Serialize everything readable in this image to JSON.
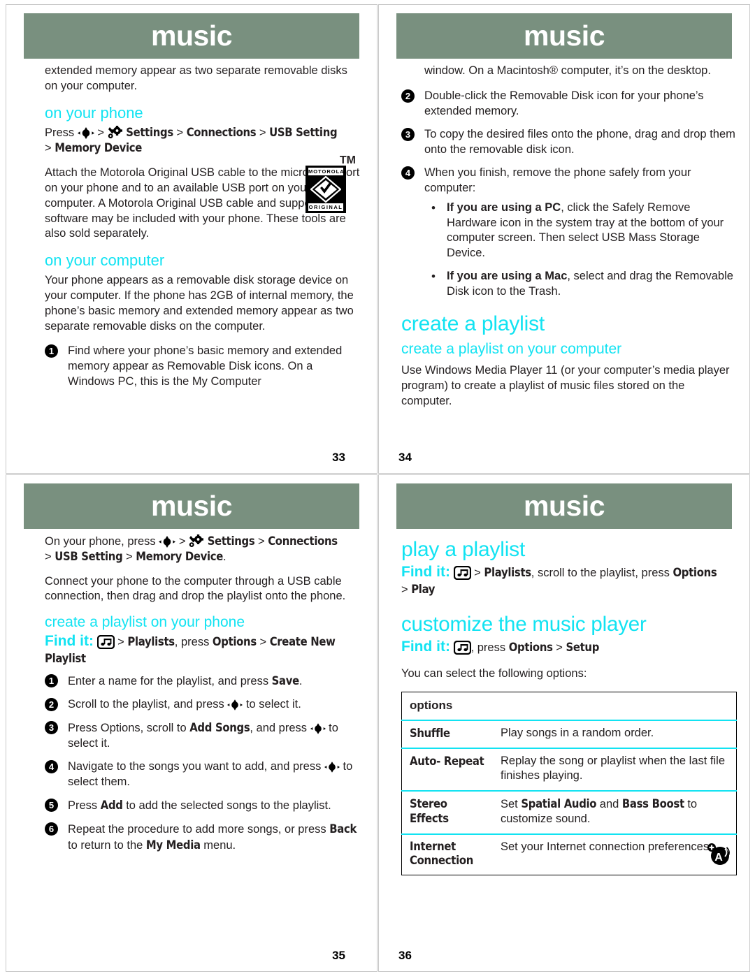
{
  "banner_title": "music",
  "colors": {
    "banner_green": "#79907f",
    "accent_cyan": "#12e3f2",
    "text": "#231f20"
  },
  "pages": [
    {
      "id": "33",
      "number": "33",
      "intro": "extended memory appear as two separate removable disks on your computer.",
      "h_phone": "on your phone",
      "path_press": "Press",
      "path_settings": "Settings",
      "path_connections": "Connections",
      "path_usb": "USB Setting",
      "path_memdev": "Memory Device",
      "gt": ">",
      "attach_para": "Attach the Motorola Original USB cable to the micro-USB port on your phone and to an available USB port on your computer. A Motorola Original USB cable and supporting software may be included with your phone. These tools are also sold separately.",
      "logo_top": "MOTOROLA",
      "logo_bottom": "ORIGINAL",
      "logo_tm": "TM",
      "h_computer": "on your computer",
      "computer_para": "Your phone appears as a removable disk storage device on your computer. If the phone has 2GB of internal memory, the phone’s basic memory and extended memory appear as two separate removable disks on the computer.",
      "step1_num": "❶",
      "step1": "Find where your phone’s basic memory and extended memory appear as Removable Disk icons. On a Windows PC, this is the My Computer"
    },
    {
      "id": "34",
      "number": "34",
      "cont": "window. On a Macintosh® computer, it’s on the desktop.",
      "step2_num": "❷",
      "step2": "Double-click the Removable Disk icon for your phone’s extended memory.",
      "step3_num": "❸",
      "step3": "To copy the desired files onto the phone, drag and drop them onto the removable disk icon.",
      "step4_num": "❹",
      "step4": "When you finish, remove the phone safely from your computer:",
      "bullet_dot": "•",
      "b1_bold": "If you are using a PC",
      "b1_rest": ", click the Safely Remove Hardware icon in the system tray at the bottom of your computer screen. Then select USB Mass Storage Device.",
      "b2_bold": "If you are using a Mac",
      "b2_rest": ", select and drag the Removable Disk icon to the Trash.",
      "h_create": "create a playlist",
      "h_create_computer": "create a playlist on your computer",
      "wmp_para": "Use Windows Media Player 11 (or your computer’s media player program) to create a playlist of music files stored on the computer."
    },
    {
      "id": "35",
      "number": "35",
      "path_prefix": "On your phone, press",
      "gt": ">",
      "path_settings": "Settings",
      "path_connections": "Connections",
      "path_usb": "USB Setting",
      "path_memdev": "Memory Device",
      "path_period": ".",
      "connect_para": "Connect your phone to the computer through a USB cable connection, then drag and drop the playlist onto the phone.",
      "h_create_phone": "create a playlist on your phone",
      "findit_label": "Find it:",
      "findit_playlists": "Playlists",
      "findit_press": ", press",
      "findit_options": "Options",
      "findit_create": "Create New Playlist",
      "steps": [
        {
          "num": "❶",
          "pre": "Enter a name for the playlist, and press ",
          "bold": "Save",
          "post": "."
        },
        {
          "num": "❷",
          "pre": "Scroll to the playlist, and press ",
          "bold": "",
          "post": " to select it.",
          "nav": true
        },
        {
          "num": "❸",
          "pre": "Press Options, scroll to ",
          "bold": "Add Songs",
          "post": ", and press  to select it.",
          "nav": true
        },
        {
          "num": "❹",
          "pre": "Navigate to the songs you want to add, and press ",
          "bold": "",
          "post": " to select them.",
          "nav": true
        },
        {
          "num": "❺",
          "pre": "Press ",
          "bold": "Add",
          "post": " to add the selected songs to the playlist."
        },
        {
          "num": "❻",
          "pre": "Repeat the procedure to add more songs, or press ",
          "bold": "Back",
          "post": " to return to the ",
          "bold2": "My Media",
          "post2": " menu."
        }
      ]
    },
    {
      "id": "36",
      "number": "36",
      "h_play": "play a playlist",
      "findit_label": "Find it:",
      "play_playlists": "Playlists",
      "play_scroll": ", scroll to the playlist, press",
      "play_options": "Options",
      "play_gt": ">",
      "play_play": "Play",
      "h_customize": "customize the music player",
      "cust_press": ", press",
      "cust_options": "Options",
      "cust_gt": ">",
      "cust_setup": "Setup",
      "select_para": "You can select the following options:",
      "table": {
        "header": "options",
        "rows": [
          {
            "key": "Shuffle",
            "value_pre": "Play songs in a random order.",
            "value_bold1": "",
            "value_mid": "",
            "value_bold2": "",
            "value_post": ""
          },
          {
            "key": "Auto- Repeat",
            "value_pre": "Replay the song or playlist when the last file finishes playing.",
            "value_bold1": "",
            "value_mid": "",
            "value_bold2": "",
            "value_post": ""
          },
          {
            "key": "Stereo Effects",
            "value_pre": "Set ",
            "value_bold1": "Spatial Audio",
            "value_mid": " and ",
            "value_bold2": "Bass Boost",
            "value_post": " to customize sound."
          },
          {
            "key": "Internet Connection",
            "value_pre": "Set your Internet connection preferences.",
            "value_bold1": "",
            "value_mid": "",
            "value_bold2": "",
            "value_post": ""
          }
        ]
      }
    }
  ]
}
